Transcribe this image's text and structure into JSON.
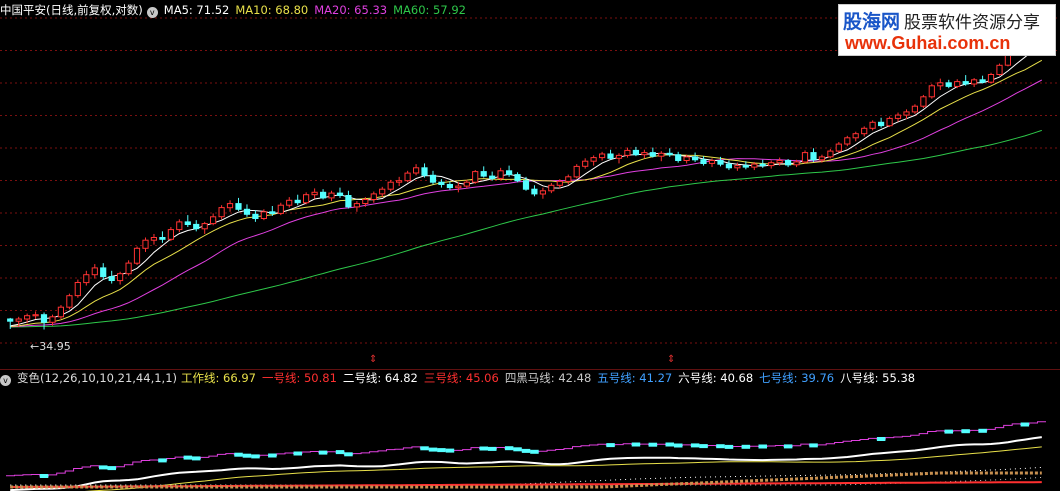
{
  "main_header": {
    "stock_title": "中国平安(日线,前复权,对数)",
    "ma_items": [
      {
        "label": "MA5: 71.52",
        "color": "#ffffff"
      },
      {
        "label": "MA10: 68.80",
        "color": "#e8e04a"
      },
      {
        "label": "MA20: 65.33",
        "color": "#e040e0"
      },
      {
        "label": "MA60: 57.92",
        "color": "#2ec84a"
      }
    ]
  },
  "sub_header": {
    "indicator_title": "变色(12,26,10,10,21,44,1,1)",
    "lines": [
      {
        "label": "工作线: 66.97",
        "color": "#e8e04a"
      },
      {
        "label": "一号线: 50.81",
        "color": "#ff3030"
      },
      {
        "label": "二号线: 64.82",
        "color": "#ffffff"
      },
      {
        "label": "三号线: 45.06",
        "color": "#ff3030"
      },
      {
        "label": "四黑马线: 42.48",
        "color": "#c8c8c8"
      },
      {
        "label": "五号线: 41.27",
        "color": "#40a0ff"
      },
      {
        "label": "六号线: 40.68",
        "color": "#ffffff"
      },
      {
        "label": "七号线: 39.76",
        "color": "#40a0ff"
      },
      {
        "label": "八号线: 55.38",
        "color": "#ffffff"
      }
    ]
  },
  "chart_annotations": {
    "low_price_label": "34.95"
  },
  "watermark": {
    "brand": "股海网",
    "slogan": "股票软件资源分享",
    "url": "www.Guhai.com.cn"
  },
  "colors": {
    "up_candle": "#ff3232",
    "down_candle": "#54ffff",
    "grid": "#7a1010",
    "ma5": "#ffffff",
    "ma10": "#e8e04a",
    "ma20": "#e040e0",
    "ma60": "#2ec84a"
  },
  "chart_data": {
    "type": "candlestick",
    "scale": "log",
    "ylim": [
      33,
      77
    ],
    "ohlc": [
      [
        35.9,
        36.0,
        35.0,
        35.7
      ],
      [
        35.7,
        36.1,
        35.2,
        35.9
      ],
      [
        35.9,
        36.4,
        35.5,
        36.2
      ],
      [
        36.2,
        36.6,
        35.9,
        36.3
      ],
      [
        36.3,
        36.5,
        34.95,
        35.6
      ],
      [
        35.6,
        36.3,
        35.3,
        36.1
      ],
      [
        36.1,
        37.2,
        35.9,
        37.0
      ],
      [
        37.0,
        38.3,
        36.8,
        38.1
      ],
      [
        38.1,
        39.7,
        37.9,
        39.4
      ],
      [
        39.4,
        40.6,
        39.1,
        40.2
      ],
      [
        40.2,
        41.3,
        39.8,
        40.9
      ],
      [
        40.9,
        41.4,
        39.7,
        40.0
      ],
      [
        40.0,
        40.6,
        39.3,
        39.6
      ],
      [
        39.6,
        40.5,
        39.2,
        40.3
      ],
      [
        40.3,
        41.7,
        40.1,
        41.4
      ],
      [
        41.4,
        43.2,
        41.2,
        43.0
      ],
      [
        43.0,
        44.2,
        42.6,
        43.9
      ],
      [
        43.9,
        44.6,
        43.4,
        44.2
      ],
      [
        44.2,
        44.9,
        43.6,
        44.0
      ],
      [
        44.0,
        45.4,
        43.8,
        45.1
      ],
      [
        45.1,
        46.3,
        44.8,
        46.0
      ],
      [
        46.0,
        46.8,
        45.4,
        45.7
      ],
      [
        45.7,
        46.2,
        44.9,
        45.2
      ],
      [
        45.2,
        46.0,
        44.6,
        45.8
      ],
      [
        45.8,
        47.0,
        45.6,
        46.6
      ],
      [
        46.6,
        48.0,
        46.3,
        47.7
      ],
      [
        47.7,
        48.6,
        47.2,
        48.2
      ],
      [
        48.2,
        48.9,
        47.3,
        47.5
      ],
      [
        47.5,
        48.1,
        46.6,
        46.9
      ],
      [
        46.9,
        47.4,
        46.0,
        46.4
      ],
      [
        46.4,
        47.5,
        46.2,
        47.2
      ],
      [
        47.2,
        47.9,
        46.7,
        47.0
      ],
      [
        47.0,
        48.3,
        46.8,
        48.0
      ],
      [
        48.0,
        49.0,
        47.7,
        48.6
      ],
      [
        48.6,
        49.3,
        48.0,
        48.3
      ],
      [
        48.3,
        49.6,
        48.1,
        49.3
      ],
      [
        49.3,
        50.1,
        48.8,
        49.6
      ],
      [
        49.6,
        50.0,
        48.7,
        48.9
      ],
      [
        48.9,
        49.8,
        48.5,
        49.5
      ],
      [
        49.5,
        50.2,
        48.9,
        49.2
      ],
      [
        49.2,
        49.8,
        47.6,
        47.8
      ],
      [
        47.8,
        48.5,
        47.2,
        48.2
      ],
      [
        48.2,
        49.0,
        47.8,
        48.7
      ],
      [
        48.7,
        49.7,
        48.3,
        49.4
      ],
      [
        49.4,
        50.3,
        49.0,
        50.0
      ],
      [
        50.0,
        51.2,
        49.7,
        50.9
      ],
      [
        50.9,
        51.6,
        50.4,
        51.1
      ],
      [
        51.1,
        52.4,
        50.9,
        52.1
      ],
      [
        52.1,
        53.3,
        51.8,
        52.8
      ],
      [
        52.8,
        53.4,
        51.5,
        51.8
      ],
      [
        51.8,
        52.4,
        50.6,
        50.9
      ],
      [
        50.9,
        51.3,
        50.2,
        50.6
      ],
      [
        50.6,
        51.0,
        49.9,
        50.2
      ],
      [
        50.2,
        50.9,
        49.6,
        50.4
      ],
      [
        50.4,
        51.2,
        50.1,
        50.9
      ],
      [
        50.9,
        52.5,
        50.7,
        52.3
      ],
      [
        52.3,
        53.0,
        51.5,
        51.7
      ],
      [
        51.7,
        52.3,
        51.1,
        51.4
      ],
      [
        51.4,
        52.8,
        51.2,
        52.4
      ],
      [
        52.4,
        53.1,
        51.6,
        51.9
      ],
      [
        51.9,
        52.2,
        50.9,
        51.1
      ],
      [
        51.1,
        51.6,
        49.8,
        50.0
      ],
      [
        50.0,
        50.5,
        49.1,
        49.4
      ],
      [
        49.4,
        50.2,
        48.8,
        49.8
      ],
      [
        49.8,
        50.8,
        49.5,
        50.5
      ],
      [
        50.5,
        51.3,
        50.1,
        51.0
      ],
      [
        51.0,
        51.9,
        50.6,
        51.6
      ],
      [
        51.6,
        53.3,
        51.4,
        53.0
      ],
      [
        53.0,
        54.1,
        52.7,
        53.7
      ],
      [
        53.7,
        54.5,
        53.1,
        54.2
      ],
      [
        54.2,
        55.0,
        53.8,
        54.7
      ],
      [
        54.7,
        55.3,
        53.9,
        54.1
      ],
      [
        54.1,
        54.8,
        53.4,
        54.5
      ],
      [
        54.5,
        55.6,
        54.2,
        55.2
      ],
      [
        55.2,
        55.7,
        54.4,
        54.6
      ],
      [
        54.6,
        55.3,
        54.1,
        54.9
      ],
      [
        54.9,
        55.6,
        54.2,
        54.4
      ],
      [
        54.4,
        55.1,
        53.7,
        54.8
      ],
      [
        54.8,
        55.5,
        54.3,
        54.6
      ],
      [
        54.6,
        55.0,
        53.5,
        53.8
      ],
      [
        53.8,
        54.6,
        53.4,
        54.3
      ],
      [
        54.3,
        54.9,
        53.6,
        53.9
      ],
      [
        53.9,
        54.4,
        53.1,
        53.4
      ],
      [
        53.4,
        54.1,
        52.9,
        53.8
      ],
      [
        53.8,
        54.3,
        53.0,
        53.3
      ],
      [
        53.3,
        53.8,
        52.5,
        52.8
      ],
      [
        52.8,
        53.5,
        52.4,
        53.1
      ],
      [
        53.1,
        53.7,
        52.6,
        52.9
      ],
      [
        52.9,
        53.6,
        52.5,
        53.3
      ],
      [
        53.3,
        53.9,
        52.8,
        53.1
      ],
      [
        53.1,
        53.8,
        52.7,
        53.5
      ],
      [
        53.5,
        54.2,
        53.1,
        53.8
      ],
      [
        53.8,
        54.0,
        52.9,
        53.2
      ],
      [
        53.2,
        53.9,
        52.9,
        53.6
      ],
      [
        53.6,
        55.2,
        53.4,
        54.9
      ],
      [
        54.9,
        55.5,
        53.6,
        53.9
      ],
      [
        53.9,
        54.6,
        53.5,
        54.3
      ],
      [
        54.3,
        55.4,
        54.1,
        55.1
      ],
      [
        55.1,
        56.4,
        54.9,
        56.1
      ],
      [
        56.1,
        57.3,
        55.8,
        57.0
      ],
      [
        57.0,
        57.9,
        56.5,
        57.6
      ],
      [
        57.6,
        58.7,
        57.2,
        58.4
      ],
      [
        58.4,
        59.6,
        58.1,
        59.3
      ],
      [
        59.3,
        60.0,
        58.5,
        58.8
      ],
      [
        58.8,
        60.2,
        58.6,
        59.9
      ],
      [
        59.9,
        60.8,
        59.4,
        60.4
      ],
      [
        60.4,
        61.3,
        59.8,
        60.9
      ],
      [
        60.9,
        62.1,
        60.6,
        61.8
      ],
      [
        61.8,
        63.6,
        61.5,
        63.3
      ],
      [
        63.3,
        65.4,
        63.0,
        65.1
      ],
      [
        65.1,
        66.3,
        64.4,
        65.6
      ],
      [
        65.6,
        66.1,
        64.7,
        65.0
      ],
      [
        65.0,
        66.2,
        64.7,
        65.8
      ],
      [
        65.8,
        66.9,
        65.1,
        65.4
      ],
      [
        65.4,
        66.4,
        64.9,
        66.1
      ],
      [
        66.1,
        66.8,
        65.5,
        65.7
      ],
      [
        65.7,
        67.3,
        65.5,
        67.0
      ],
      [
        67.0,
        68.9,
        66.8,
        68.6
      ],
      [
        68.6,
        71.0,
        68.4,
        70.7
      ],
      [
        70.7,
        72.6,
        70.3,
        72.2
      ],
      [
        72.2,
        73.4,
        71.4,
        71.6
      ],
      [
        71.6,
        73.7,
        71.4,
        73.1
      ],
      [
        73.1,
        75.2,
        72.7,
        74.4
      ]
    ]
  }
}
